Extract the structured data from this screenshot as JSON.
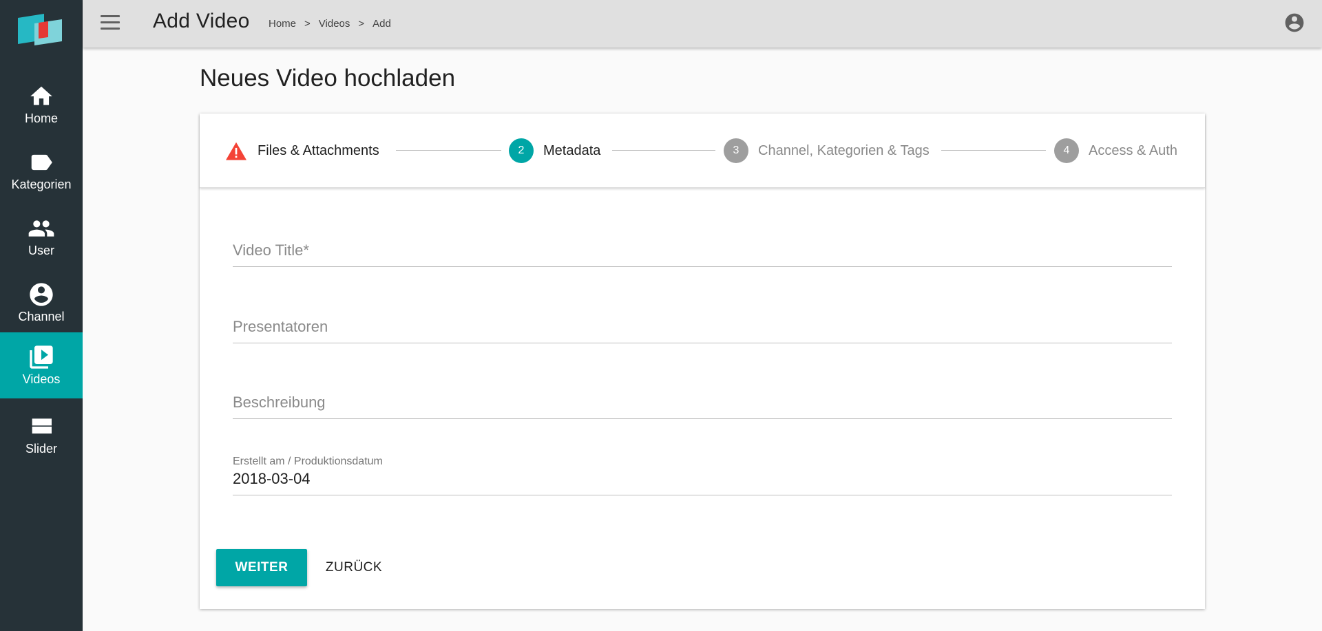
{
  "sidebar": {
    "logo_icon": "app-logo",
    "items": [
      {
        "label": "Home",
        "icon": "home-icon"
      },
      {
        "label": "Kategorien",
        "icon": "label-icon"
      },
      {
        "label": "User",
        "icon": "people-icon"
      },
      {
        "label": "Channel",
        "icon": "account-circle-icon"
      },
      {
        "label": "Videos",
        "icon": "video-library-icon",
        "active": true
      },
      {
        "label": "Slider",
        "icon": "view-stream-icon"
      }
    ]
  },
  "topbar": {
    "title": "Add Video",
    "breadcrumb": [
      "Home",
      "Videos",
      "Add"
    ],
    "breadcrumb_separator": ">"
  },
  "main": {
    "page_title": "Neues Video hochladen",
    "stepper": {
      "steps": [
        {
          "number": "",
          "label": "Files & Attachments",
          "state": "error"
        },
        {
          "number": "2",
          "label": "Metadata",
          "state": "active"
        },
        {
          "number": "3",
          "label": "Channel, Kategorien & Tags",
          "state": "inactive"
        },
        {
          "number": "4",
          "label": "Access & Auth",
          "state": "inactive"
        }
      ]
    },
    "form": {
      "title_placeholder": "Video Title*",
      "title_value": "",
      "presenters_placeholder": "Presentatoren",
      "presenters_value": "",
      "description_placeholder": "Beschreibung",
      "description_value": "",
      "date_label": "Erstellt am / Produktionsdatum",
      "date_value": "2018-03-04"
    },
    "buttons": {
      "next": "WEITER",
      "back": "ZURÜCK"
    }
  },
  "colors": {
    "accent": "#00a6a6",
    "sidebar_bg": "#263238",
    "topbar_bg": "#e0e0e0",
    "error": "#f44336"
  }
}
